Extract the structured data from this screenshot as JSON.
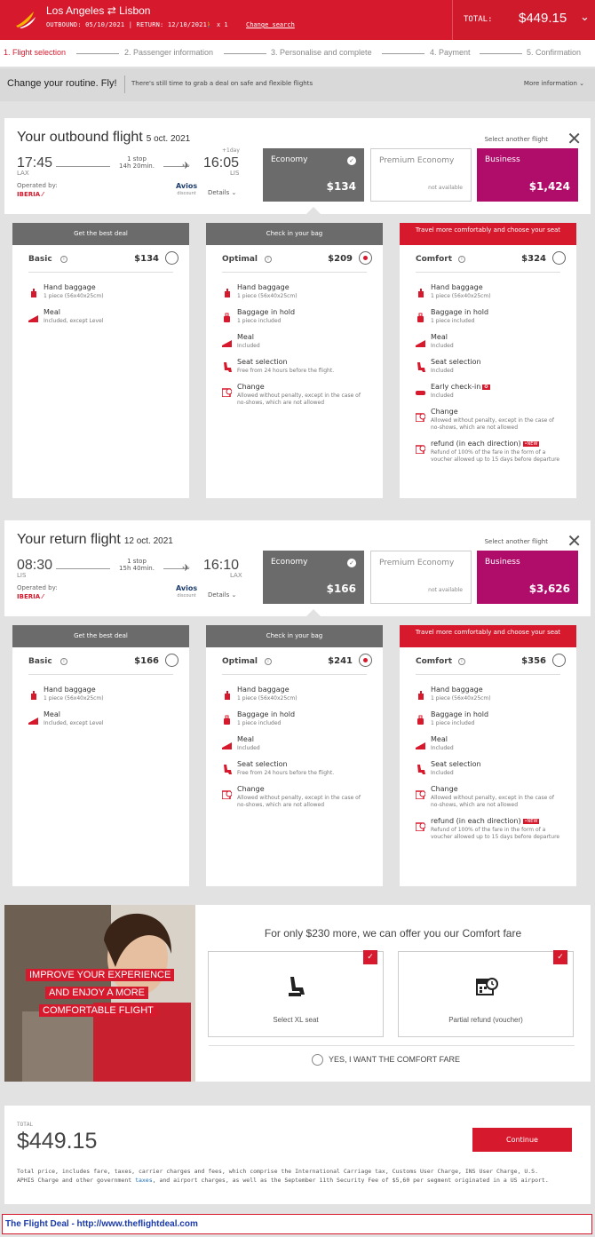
{
  "header": {
    "route": "Los Angeles ⇄ Lisbon",
    "dates": "OUTBOUND: 05/10/2021 | RETURN: 12/10/2021",
    "passengers": "x 1",
    "change_search": "Change search",
    "total_label": "TOTAL:",
    "total_value": "$449.15"
  },
  "steps": [
    "1. Flight selection",
    "2. Passenger information",
    "3. Personalise and complete",
    "4. Payment",
    "5. Confirmation"
  ],
  "promo": {
    "title": "Change your routine. Fly!",
    "text": "There's still time to grab a deal on safe and flexible flights",
    "more": "More information"
  },
  "outbound": {
    "title": "Your outbound flight",
    "date": "5 oct. 2021",
    "select_another": "Select another flight",
    "dep_time": "17:45",
    "dep_airport": "LAX",
    "stops": "1 stop",
    "duration": "14h 20min.",
    "arr_time": "16:05",
    "arr_airport": "LIS",
    "plus_day": "+1day",
    "operated_by": "Operated by:",
    "operator": "IBERIA",
    "avios": "Avios",
    "avios_sub": "discount",
    "details": "Details",
    "cabins": [
      {
        "name": "Economy",
        "price": "$134"
      },
      {
        "name": "Premium Economy",
        "price": "not available"
      },
      {
        "name": "Business",
        "price": "$1,424"
      }
    ],
    "fares": [
      {
        "header": "Get the best deal",
        "name": "Basic",
        "price": "$134",
        "selected": false,
        "features": [
          {
            "icon": "hand-baggage-icon",
            "title": "Hand baggage",
            "sub": "1 piece (56x40x25cm)"
          },
          {
            "icon": "meal-icon",
            "title": "Meal",
            "sub": "Included, except Level"
          }
        ]
      },
      {
        "header": "Check in your bag",
        "name": "Optimal",
        "price": "$209",
        "selected": true,
        "features": [
          {
            "icon": "hand-baggage-icon",
            "title": "Hand baggage",
            "sub": "1 piece (56x40x25cm)"
          },
          {
            "icon": "hold-baggage-icon",
            "title": "Baggage in hold",
            "sub": "1 piece included"
          },
          {
            "icon": "meal-icon",
            "title": "Meal",
            "sub": "Included"
          },
          {
            "icon": "seat-icon",
            "title": "Seat selection",
            "sub": "Free from 24 hours before the flight."
          },
          {
            "icon": "change-icon",
            "title": "Change",
            "sub": "Allowed without penalty, except in the case of no-shows, which are not allowed"
          }
        ]
      },
      {
        "header": "Travel more comfortably and choose your seat",
        "name": "Comfort",
        "price": "$324",
        "selected": false,
        "features": [
          {
            "icon": "hand-baggage-icon",
            "title": "Hand baggage",
            "sub": "1 piece (56x40x25cm)"
          },
          {
            "icon": "hold-baggage-icon",
            "title": "Baggage in hold",
            "sub": "1 piece included"
          },
          {
            "icon": "meal-icon",
            "title": "Meal",
            "sub": "Included"
          },
          {
            "icon": "seat-icon",
            "title": "Seat selection",
            "sub": "Included"
          },
          {
            "icon": "early-checkin-icon",
            "title": "Early check-in",
            "sub": "Included"
          },
          {
            "icon": "change-icon",
            "title": "Change",
            "sub": "Allowed without penalty, except in the case of no-shows, which are not allowed"
          },
          {
            "icon": "refund-icon",
            "title": "refund (in each direction)",
            "badge": "NEW",
            "sub": "Refund of 100% of the fare in the form of a voucher allowed up to 15 days before departure"
          }
        ]
      }
    ]
  },
  "return": {
    "title": "Your return flight",
    "date": "12 oct. 2021",
    "select_another": "Select another flight",
    "dep_time": "08:30",
    "dep_airport": "LIS",
    "stops": "1 stop",
    "duration": "15h 40min.",
    "arr_time": "16:10",
    "arr_airport": "LAX",
    "plus_day": "",
    "operated_by": "Operated by:",
    "operator": "IBERIA",
    "avios": "Avios",
    "avios_sub": "discount",
    "details": "Details",
    "cabins": [
      {
        "name": "Economy",
        "price": "$166"
      },
      {
        "name": "Premium Economy",
        "price": "not available"
      },
      {
        "name": "Business",
        "price": "$3,626"
      }
    ],
    "fares": [
      {
        "header": "Get the best deal",
        "name": "Basic",
        "price": "$166",
        "selected": false,
        "features": [
          {
            "icon": "hand-baggage-icon",
            "title": "Hand baggage",
            "sub": "1 piece (56x40x25cm)"
          },
          {
            "icon": "meal-icon",
            "title": "Meal",
            "sub": "Included, except Level"
          }
        ]
      },
      {
        "header": "Check in your bag",
        "name": "Optimal",
        "price": "$241",
        "selected": true,
        "features": [
          {
            "icon": "hand-baggage-icon",
            "title": "Hand baggage",
            "sub": "1 piece (56x40x25cm)"
          },
          {
            "icon": "hold-baggage-icon",
            "title": "Baggage in hold",
            "sub": "1 piece included"
          },
          {
            "icon": "meal-icon",
            "title": "Meal",
            "sub": "Included"
          },
          {
            "icon": "seat-icon",
            "title": "Seat selection",
            "sub": "Free from 24 hours before the flight."
          },
          {
            "icon": "change-icon",
            "title": "Change",
            "sub": "Allowed without penalty, except in the case of no-shows, which are not allowed"
          }
        ]
      },
      {
        "header": "Travel more comfortably and choose your seat",
        "name": "Comfort",
        "price": "$356",
        "selected": false,
        "features": [
          {
            "icon": "hand-baggage-icon",
            "title": "Hand baggage",
            "sub": "1 piece (56x40x25cm)"
          },
          {
            "icon": "hold-baggage-icon",
            "title": "Baggage in hold",
            "sub": "1 piece included"
          },
          {
            "icon": "meal-icon",
            "title": "Meal",
            "sub": "Included"
          },
          {
            "icon": "seat-icon",
            "title": "Seat selection",
            "sub": "Included"
          },
          {
            "icon": "change-icon",
            "title": "Change",
            "sub": "Allowed without penalty, except in the case of no-shows, which are not allowed"
          },
          {
            "icon": "refund-icon",
            "title": "refund (in each direction)",
            "badge": "NEW",
            "sub": "Refund of 100% of the fare in the form of a voucher allowed up to 15 days before departure"
          }
        ]
      }
    ]
  },
  "upsell": {
    "image_text": [
      "IMPROVE YOUR EXPERIENCE",
      "AND ENJOY A MORE",
      "COMFORTABLE FLIGHT"
    ],
    "headline": "For only $230 more, we can offer you our Comfort fare",
    "option1": "Select XL seat",
    "option2": "Partial refund (voucher)",
    "yes_label": "YES, I WANT THE COMFORT FARE"
  },
  "total": {
    "label": "TOTAL",
    "value": "$449.15",
    "continue": "Continue",
    "legal_1": "Total price, includes fare, taxes, carrier charges and fees, which comprise the International Carriage tax, Customs User Charge, INS User Charge, U.S. APHIS Charge and other government ",
    "legal_link": "taxes",
    "legal_2": ", and airport charges, as well as the September 11th Security Fee of $5,60 per segment originated in a US airport."
  },
  "footer": "The Flight Deal - http://www.theflightdeal.com",
  "colors": {
    "brand": "#d7192d",
    "business": "#b00d6b",
    "economy": "#6b6b6b"
  }
}
